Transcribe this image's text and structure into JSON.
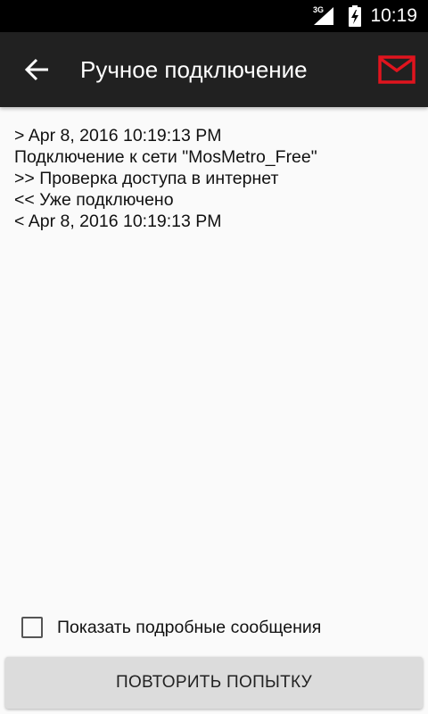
{
  "status_bar": {
    "network": "3G",
    "time": "10:19",
    "icons": [
      "signal-icon",
      "battery-charging-icon"
    ]
  },
  "app_bar": {
    "title": "Ручное подключение",
    "back_icon": "arrow-left-icon",
    "mail_icon": "mail-icon",
    "accent_color": "#e0141e"
  },
  "log": {
    "lines": [
      "> Apr 8, 2016 10:19:13 PM",
      "Подключение к сети \"MosMetro_Free\"",
      ">> Проверка доступа в интернет",
      "<< Уже подключено",
      "< Apr 8, 2016 10:19:13 PM"
    ]
  },
  "options": {
    "show_details_label": "Показать подробные сообщения",
    "show_details_checked": false
  },
  "actions": {
    "retry_label": "ПОВТОРИТЬ ПОПЫТКУ"
  }
}
